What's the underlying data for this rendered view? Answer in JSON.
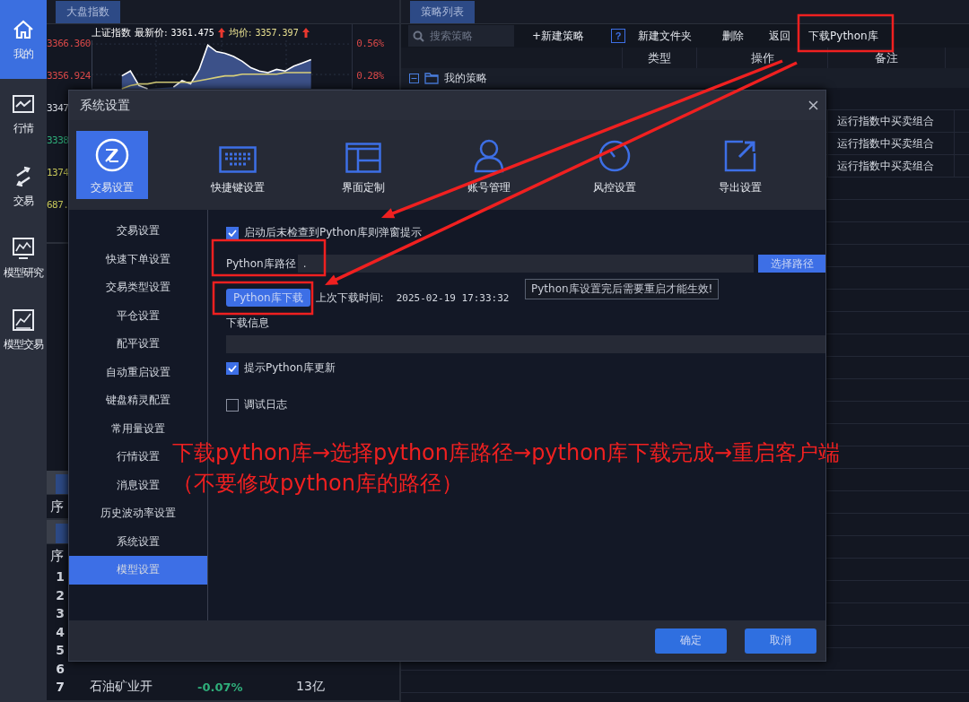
{
  "sidebar": {
    "items": [
      {
        "label": "我的",
        "selected": true,
        "kind": "home"
      },
      {
        "label": "行情",
        "selected": false,
        "kind": "chart"
      },
      {
        "label": "交易",
        "selected": false,
        "kind": "trade"
      },
      {
        "label": "模型研究",
        "selected": false,
        "kind": "research"
      },
      {
        "label": "模型交易",
        "selected": false,
        "kind": "model"
      }
    ]
  },
  "index_panel": {
    "tab": "大盘指数",
    "index_name": "上证指数",
    "latest_label": "最新价:",
    "latest_value": "3361.475",
    "avg_label": "均价:",
    "avg_value": "3357.397",
    "left_axis": [
      {
        "label": "3347",
        "color": "#d8dce4"
      },
      {
        "label": "3338",
        "color": "#2fae7a"
      },
      {
        "label": "1374",
        "color": "#c8c85a"
      },
      {
        "label": "687.",
        "color": "#c8c85a"
      }
    ],
    "right_axis": [
      "0.56%",
      "0.28%"
    ],
    "chart_data": {
      "type": "area",
      "grid": true,
      "ylim": [
        3352.5,
        3367.5
      ],
      "yticks": [
        {
          "value": 3366.36,
          "label": "3366.360"
        },
        {
          "value": 3356.924,
          "label": "3356.924"
        }
      ],
      "series": [
        {
          "color": "#ffffff",
          "values": [
            null,
            null,
            null,
            3356.5,
            3358.0,
            3353.5,
            3352.5,
            null,
            null,
            3353.0,
            3355.0,
            3354.0,
            3358.5,
            3366.0,
            3364.0,
            3363.5,
            3362.5,
            3361.0,
            3359.0,
            3358.0,
            3357.5,
            3358.5,
            3358.0,
            3359.5,
            3360.5,
            3361.5,
            null,
            null,
            null,
            null
          ]
        },
        {
          "type": "line",
          "color": "#d8d07a",
          "values": [
            null,
            null,
            null,
            3352.5,
            3353.5,
            3354.0,
            3354.0,
            3354.5,
            3354.5,
            3354.5,
            3354.5,
            3354.5,
            3355.0,
            3355.5,
            3356.0,
            3356.5,
            3356.5,
            3357.0,
            3357.0,
            3357.0,
            3357.0,
            3357.0,
            3357.5,
            3357.5,
            3357.5,
            3357.5,
            null,
            null,
            null,
            null
          ]
        }
      ]
    }
  },
  "quotes_panel": {
    "header": "序"
  },
  "sector_panel": {
    "header": "序",
    "rows": [
      {
        "index": "1"
      },
      {
        "index": "2"
      },
      {
        "index": "3"
      },
      {
        "index": "4"
      },
      {
        "index": "5"
      },
      {
        "index": "6"
      },
      {
        "index": "7",
        "name": "石油矿业开",
        "change": "-0.07%",
        "amount": "13亿"
      }
    ]
  },
  "strategy_panel": {
    "tab": "策略列表",
    "search": {
      "placeholder": "搜索策略"
    },
    "toolbar": [
      {
        "label": "+新建策略",
        "kind": "button"
      },
      {
        "label": "?",
        "kind": "help"
      },
      {
        "label": "新建文件夹",
        "kind": "button"
      },
      {
        "label": "删除",
        "kind": "button"
      },
      {
        "label": "返回",
        "kind": "button"
      },
      {
        "label": "下载Python库",
        "kind": "button"
      }
    ],
    "columns": [
      "类型",
      "操作",
      "备注"
    ],
    "tree": {
      "label": "我的策略",
      "expanded": true
    },
    "rows": [
      {
        "note": "运行指数中买卖组合"
      },
      {
        "note": "运行指数中买卖组合"
      },
      {
        "note": "运行指数中买卖组合"
      }
    ]
  },
  "dialog": {
    "title": "系统设置",
    "categories": [
      {
        "label": "交易设置",
        "selected": true,
        "kind": "trade"
      },
      {
        "label": "快捷键设置",
        "selected": false,
        "kind": "keyboard"
      },
      {
        "label": "界面定制",
        "selected": false,
        "kind": "layout"
      },
      {
        "label": "账号管理",
        "selected": false,
        "kind": "account"
      },
      {
        "label": "风控设置",
        "selected": false,
        "kind": "risk"
      },
      {
        "label": "导出设置",
        "selected": false,
        "kind": "export"
      }
    ],
    "nav": [
      {
        "label": "交易设置",
        "selected": false
      },
      {
        "label": "快速下单设置",
        "selected": false
      },
      {
        "label": "交易类型设置",
        "selected": false
      },
      {
        "label": "平仓设置",
        "selected": false
      },
      {
        "label": "配平设置",
        "selected": false
      },
      {
        "label": "自动重启设置",
        "selected": false
      },
      {
        "label": "键盘精灵配置",
        "selected": false
      },
      {
        "label": "常用量设置",
        "selected": false
      },
      {
        "label": "行情设置",
        "selected": false
      },
      {
        "label": "消息设置",
        "selected": false
      },
      {
        "label": "历史波动率设置",
        "selected": false
      },
      {
        "label": "系统设置",
        "selected": false
      },
      {
        "label": "模型设置",
        "selected": true
      }
    ],
    "startup_prompt": {
      "label": "启动后未检查到Python库则弹窗提示",
      "checked": true
    },
    "path": {
      "label": "Python库路径",
      "value": ".",
      "button": "选择路径",
      "tooltip": "Python库设置完后需要重启才能生效!"
    },
    "download": {
      "button": "Python库下载",
      "last_label": "上次下载时间:",
      "last_time": "2025-02-19 17:33:32"
    },
    "info": {
      "label": "下载信息"
    },
    "update_prompt": {
      "label": "提示Python库更新",
      "checked": true
    },
    "debug_log": {
      "label": "调试日志",
      "checked": false
    },
    "buttons": [
      "确定",
      "取消"
    ]
  },
  "annotation": {
    "steps": "下载python库→选择python库路径→python库下载完成→重启客户端",
    "note": "（不要修改python库的路径）"
  }
}
